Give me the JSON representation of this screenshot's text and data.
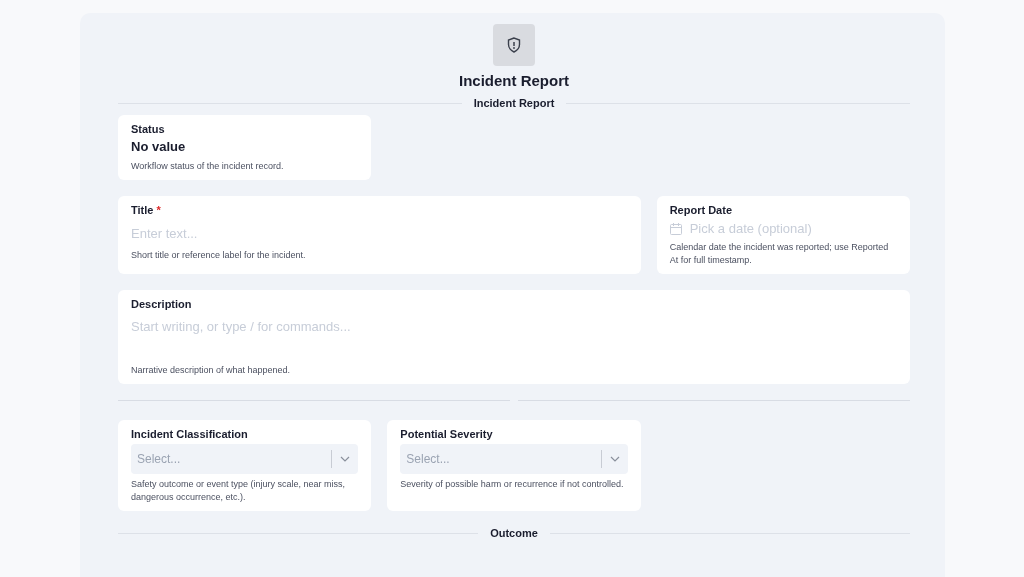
{
  "header": {
    "title": "Incident Report"
  },
  "sections": [
    {
      "title": "Incident Report",
      "rows": [
        [
          {
            "kind": "readonly",
            "label": "Status",
            "value": "No value",
            "help": "Workflow status of the incident record."
          }
        ],
        [
          {
            "kind": "text",
            "label": "Title",
            "required_mark": "*",
            "placeholder": "Enter text...",
            "help": "Short title or reference label for the incident."
          },
          {
            "kind": "date",
            "label": "Report Date",
            "placeholder": "Pick a date (optional)",
            "help": "Calendar date the incident was reported; use Reported At for full timestamp."
          }
        ],
        [
          {
            "kind": "richtext",
            "label": "Description",
            "placeholder": "Start writing, or type / for commands...",
            "help": "Narrative description of what happened."
          }
        ]
      ]
    },
    {
      "rows": [
        [
          {
            "kind": "select",
            "label": "Incident Classification",
            "placeholder": "Select...",
            "help": "Safety outcome or event type (injury scale, near miss, dangerous occurrence, etc.)."
          },
          {
            "kind": "select",
            "label": "Potential Severity",
            "placeholder": "Select...",
            "help": "Severity of possible harm or recurrence if not controlled."
          }
        ]
      ]
    },
    {
      "title": "Outcome"
    }
  ]
}
